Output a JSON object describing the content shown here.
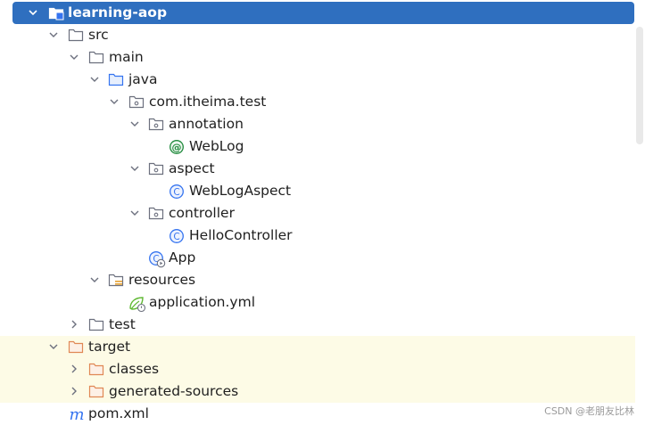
{
  "project": {
    "root_label": "learning-aop",
    "src_label": "src",
    "main_label": "main",
    "java_label": "java",
    "package_label": "com.itheima.test",
    "annotation_label": "annotation",
    "weblog_label": "WebLog",
    "aspect_label": "aspect",
    "weblogaspect_label": "WebLogAspect",
    "controller_label": "controller",
    "hellocontroller_label": "HelloController",
    "app_label": "App",
    "resources_label": "resources",
    "applicationyml_label": "application.yml",
    "test_label": "test",
    "target_label": "target",
    "classes_label": "classes",
    "generatedsources_label": "generated-sources",
    "pom_label": "pom.xml"
  },
  "watermark": "CSDN @老朋友比林",
  "colors": {
    "selection": "#2f6fbf",
    "excluded_background": "#fdfbe6",
    "folder_stroke": "#6c707e",
    "source_folder": "#3574f0",
    "excluded_folder": "#e08855",
    "class_icon": "#3574f0",
    "annotation_icon": "#208a3c",
    "maven_icon": "#3574f0"
  },
  "icons": {
    "root": "module-folder-icon",
    "folder": "folder-icon",
    "source_folder": "source-root-folder-icon",
    "package": "package-icon",
    "annotation": "annotation-type-icon",
    "class": "class-icon",
    "main_class": "runnable-class-icon",
    "resources": "resources-root-folder-icon",
    "spring_config": "spring-config-icon",
    "excluded_folder": "excluded-folder-icon",
    "maven": "maven-pom-icon",
    "expanded": "chevron-down-icon",
    "collapsed": "chevron-right-icon"
  }
}
